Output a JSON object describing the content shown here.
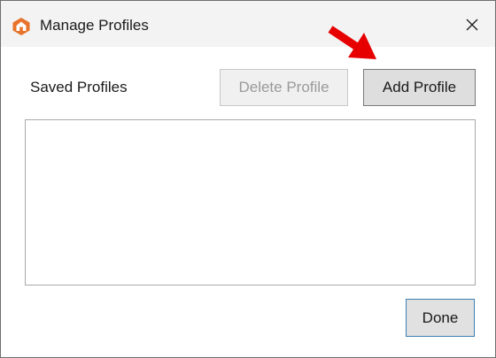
{
  "window": {
    "title": "Manage Profiles",
    "app_icon": "home-shield-icon",
    "close_glyph": "✕"
  },
  "profiles": {
    "label": "Saved Profiles",
    "items": []
  },
  "buttons": {
    "delete_label": "Delete Profile",
    "delete_enabled": false,
    "add_label": "Add Profile",
    "done_label": "Done"
  },
  "annotation": {
    "icon": "red-arrow-icon",
    "color": "#e60000"
  },
  "colors": {
    "accent": "#e8732a",
    "titlebar": "#f3f3f3",
    "done_border": "#3c7fb1"
  }
}
